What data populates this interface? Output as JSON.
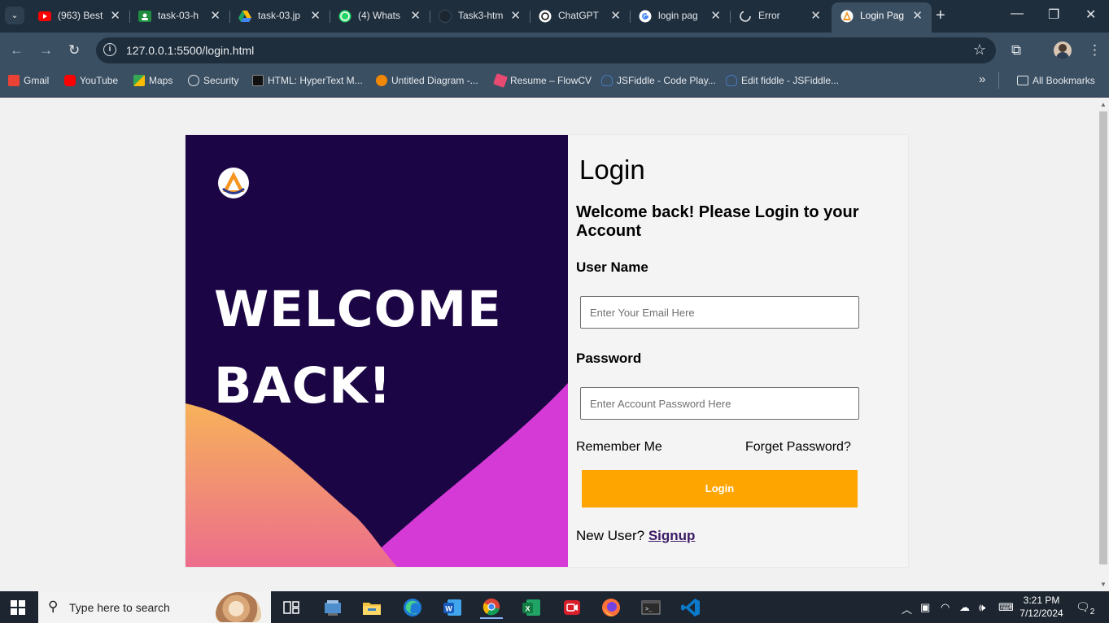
{
  "browser": {
    "tab_search_icon": "chevron-down",
    "tabs": [
      {
        "title": "(963) Best",
        "favicon": "youtube",
        "color": "#ff0000"
      },
      {
        "title": "task-03-h",
        "favicon": "google-classroom",
        "color": "#1e8e3e"
      },
      {
        "title": "task-03.jp",
        "favicon": "google-drive",
        "color": "#fbbc04"
      },
      {
        "title": "(4) Whats",
        "favicon": "whatsapp",
        "color": "#25d366"
      },
      {
        "title": "Task3-htm",
        "favicon": "github",
        "color": "#24292e"
      },
      {
        "title": "ChatGPT",
        "favicon": "chatgpt",
        "color": "#ffffff"
      },
      {
        "title": "login pag",
        "favicon": "google",
        "color": "#ffffff"
      },
      {
        "title": "Error",
        "favicon": "spinner",
        "color": "#e3e7ea"
      },
      {
        "title": "Login Pag",
        "favicon": "app-logo",
        "color": "#f7941d",
        "active": true
      }
    ],
    "new_tab": "+",
    "window_controls": [
      "minimize",
      "restore",
      "close"
    ],
    "url": "127.0.0.1:5500/login.html",
    "bookmarks": [
      {
        "label": "Gmail",
        "icon": "gmail-icon",
        "color": "#ea4335"
      },
      {
        "label": "YouTube",
        "icon": "youtube-icon",
        "color": "#ff0000"
      },
      {
        "label": "Maps",
        "icon": "maps-icon",
        "color": "#34a853"
      },
      {
        "label": "Security",
        "icon": "globe-icon",
        "color": "#dfe3e6"
      },
      {
        "label": "HTML: HyperText M...",
        "icon": "mdn-icon",
        "color": "#111111"
      },
      {
        "label": "Untitled Diagram -...",
        "icon": "drawio-icon",
        "color": "#f08705"
      },
      {
        "label": "Resume – FlowCV",
        "icon": "flowcv-icon",
        "color": "#e84a72"
      },
      {
        "label": "JSFiddle - Code Play...",
        "icon": "jsfiddle-icon",
        "color": "#4679bd"
      },
      {
        "label": "Edit fiddle - JSFiddle...",
        "icon": "jsfiddle-icon",
        "color": "#4679bd"
      }
    ],
    "bookmarks_overflow": "»",
    "all_bookmarks": "All Bookmarks"
  },
  "page": {
    "hero_title_line1": "WELCOME",
    "hero_title_line2": "BACK!",
    "login_heading": "Login",
    "subheading": "Welcome back! Please Login to your Account",
    "username_label": "User Name",
    "username_placeholder": "Enter Your Email Here",
    "password_label": "Password",
    "password_placeholder": "Enter Account Password Here",
    "remember_me": "Remember Me",
    "forgot_password": "Forget Password?",
    "login_button": "Login",
    "new_user_text": "New User?",
    "signup_link": "Signup",
    "colors": {
      "hero_bg": "#1b0545",
      "button": "#ffa500",
      "wave_orange": "#f6a95c",
      "wave_magenta": "#d63ad6"
    }
  },
  "taskbar": {
    "search_placeholder": "Type here to search",
    "apps": [
      "task-view-icon",
      "file-explorer-alt-icon",
      "file-explorer-icon",
      "edge-icon",
      "word-icon",
      "chrome-icon",
      "excel-icon",
      "recorder-icon",
      "firefox-icon",
      "terminal-icon",
      "vscode-icon"
    ],
    "time": "3:21 PM",
    "date": "7/12/2024",
    "notifications": "2"
  }
}
